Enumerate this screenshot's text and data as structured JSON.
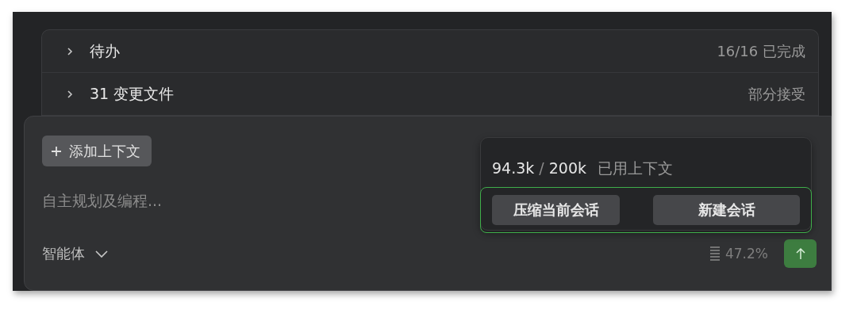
{
  "task_rows": [
    {
      "title": "待办",
      "status": "16/16 已完成",
      "expanded": false
    },
    {
      "title": "31 变更文件",
      "status": "部分接受",
      "expanded": false
    }
  ],
  "composer": {
    "add_context": "添加上下文",
    "placeholder": "自主规划及编程...",
    "agent_mode": "智能体",
    "usage": "47.2%"
  },
  "context_popover": {
    "used": "94.3k",
    "separator": "/",
    "total": "200k",
    "label": "已用上下文",
    "actions": [
      "压缩当前会话",
      "新建会话"
    ]
  }
}
